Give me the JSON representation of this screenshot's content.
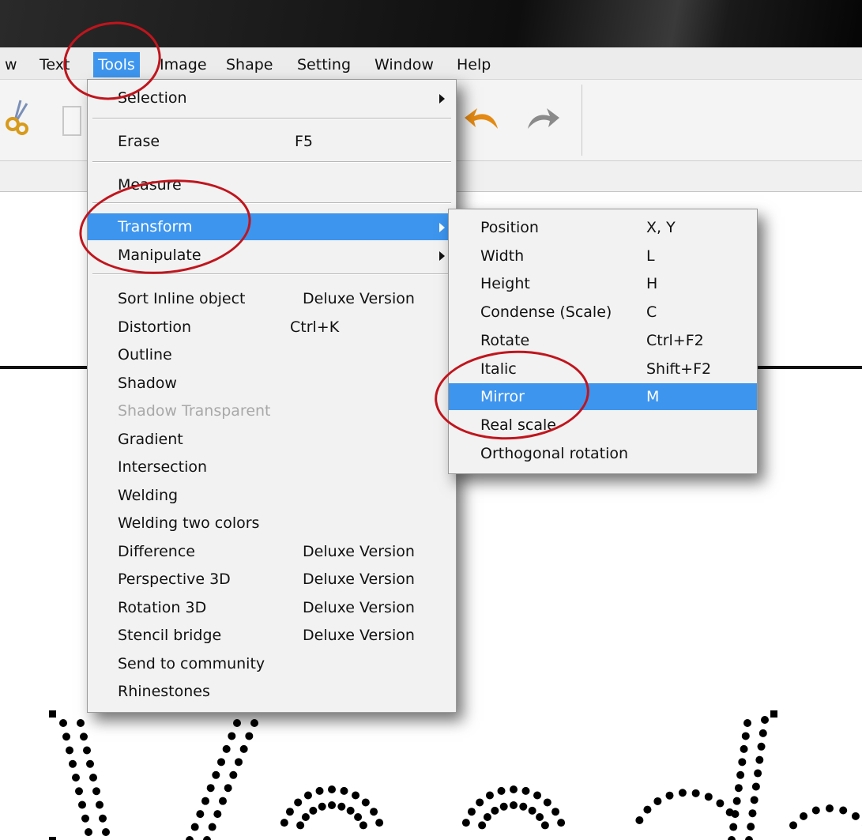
{
  "menubar": {
    "items": [
      {
        "label": "w"
      },
      {
        "label": "Text"
      },
      {
        "label": "Tools"
      },
      {
        "label": "Image"
      },
      {
        "label": "Shape"
      },
      {
        "label": "Setting"
      },
      {
        "label": "Window"
      },
      {
        "label": "Help"
      }
    ]
  },
  "toolbar": {
    "icons": [
      "scissors-icon",
      "copy-icon",
      "undo-icon",
      "redo-icon"
    ],
    "colors": {
      "undo": "#e48a14",
      "redo": "#8a8a8a"
    }
  },
  "tools_menu": {
    "items": [
      {
        "label": "Selection",
        "submenu": true
      },
      {
        "label": "Erase",
        "shortcut": "F5"
      },
      {
        "label": "Measure"
      },
      {
        "label": "Transform",
        "submenu": true,
        "highlighted": true
      },
      {
        "label": "Manipulate",
        "submenu": true
      },
      {
        "label": "Sort Inline object",
        "shortcut": "Deluxe Version"
      },
      {
        "label": "Distortion",
        "shortcut": "Ctrl+K"
      },
      {
        "label": "Outline"
      },
      {
        "label": "Shadow"
      },
      {
        "label": "Shadow Transparent",
        "disabled": true
      },
      {
        "label": "Gradient"
      },
      {
        "label": "Intersection"
      },
      {
        "label": "Welding"
      },
      {
        "label": "Welding two colors"
      },
      {
        "label": "Difference",
        "shortcut": "Deluxe Version"
      },
      {
        "label": "Perspective 3D",
        "shortcut": "Deluxe Version"
      },
      {
        "label": "Rotation 3D",
        "shortcut": "Deluxe Version"
      },
      {
        "label": "Stencil bridge",
        "shortcut": "Deluxe Version"
      },
      {
        "label": "Send to community"
      },
      {
        "label": "Rhinestones"
      }
    ]
  },
  "transform_submenu": {
    "items": [
      {
        "label": "Position",
        "shortcut": "X, Y"
      },
      {
        "label": "Width",
        "shortcut": "L"
      },
      {
        "label": "Height",
        "shortcut": "H"
      },
      {
        "label": "Condense (Scale)",
        "shortcut": "C"
      },
      {
        "label": "Rotate",
        "shortcut": "Ctrl+F2"
      },
      {
        "label": "Italic",
        "shortcut": "Shift+F2"
      },
      {
        "label": "Mirror",
        "shortcut": "M",
        "highlighted": true
      },
      {
        "label": "Real scale"
      },
      {
        "label": "Orthogonal rotation"
      }
    ]
  },
  "colors": {
    "accent": "#3d95ee",
    "annotation": "#c0151d",
    "rhinestone": "#000000"
  }
}
